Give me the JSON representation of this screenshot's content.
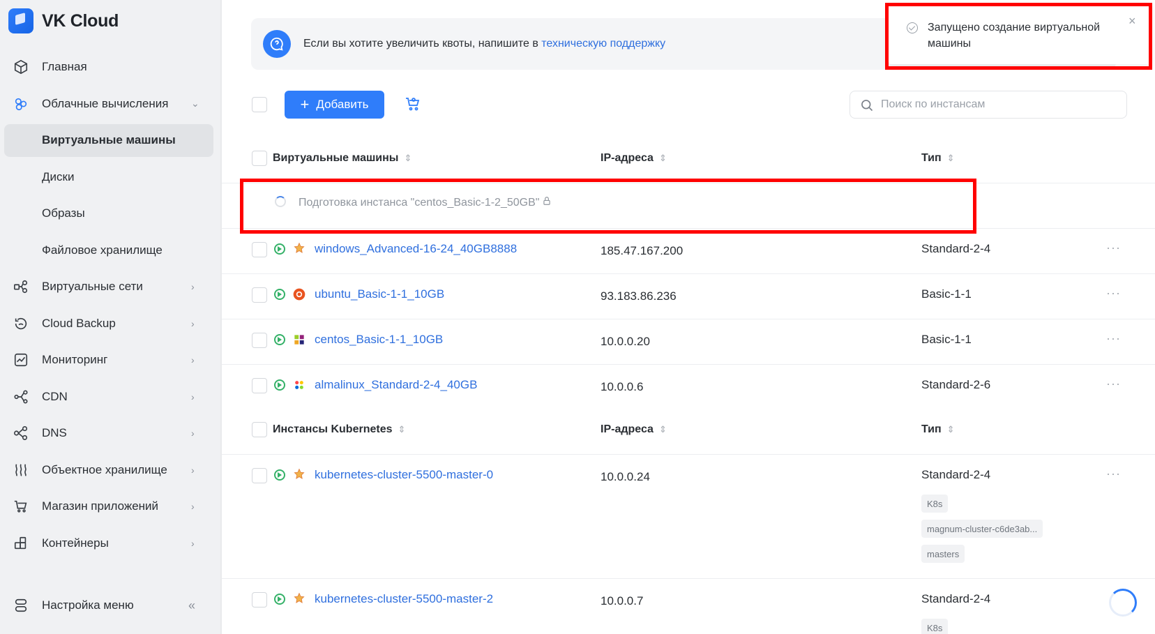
{
  "brand": {
    "name": "VK Cloud"
  },
  "sidebar": {
    "items": [
      {
        "label": "Главная",
        "icon": "cube-icon",
        "chevron": ""
      },
      {
        "label": "Облачные вычисления",
        "icon": "cloud-compute-icon",
        "chevron": "⌄"
      },
      {
        "label": "Виртуальные машины",
        "icon": "",
        "chevron": "",
        "active": true
      },
      {
        "label": "Диски",
        "icon": "",
        "chevron": ""
      },
      {
        "label": "Образы",
        "icon": "",
        "chevron": ""
      },
      {
        "label": "Файловое хранилище",
        "icon": "",
        "chevron": ""
      },
      {
        "label": "Виртуальные сети",
        "icon": "network-icon",
        "chevron": "›"
      },
      {
        "label": "Cloud Backup",
        "icon": "backup-icon",
        "chevron": "›"
      },
      {
        "label": "Мониторинг",
        "icon": "monitoring-icon",
        "chevron": "›"
      },
      {
        "label": "CDN",
        "icon": "cdn-icon",
        "chevron": "›"
      },
      {
        "label": "DNS",
        "icon": "dns-icon",
        "chevron": "›"
      },
      {
        "label": "Объектное хранилище",
        "icon": "object-storage-icon",
        "chevron": "›"
      },
      {
        "label": "Магазин приложений",
        "icon": "store-icon",
        "chevron": "›"
      },
      {
        "label": "Контейнеры",
        "icon": "containers-icon",
        "chevron": "›"
      }
    ],
    "menu_settings": "Настройка меню",
    "collapse_glyph": "«"
  },
  "banner": {
    "text": "Если вы хотите увеличить квоты, напишите в ",
    "link": "техническую поддержку"
  },
  "toolbar": {
    "add_label": "Добавить",
    "search_placeholder": "Поиск по инстансам"
  },
  "vm_table": {
    "headers": {
      "name": "Виртуальные машины",
      "ip": "IP-адреса",
      "type": "Тип"
    },
    "preparing": "Подготовка инстанса \"centos_Basic-1-2_50GB\"",
    "rows": [
      {
        "name": "windows_Advanced-16-24_40GB8888",
        "ip": "185.47.167.200",
        "type": "Standard-2-4",
        "os": "windows"
      },
      {
        "name": "ubuntu_Basic-1-1_10GB",
        "ip": "93.183.86.236",
        "type": "Basic-1-1",
        "os": "ubuntu"
      },
      {
        "name": "centos_Basic-1-1_10GB",
        "ip": "10.0.0.20",
        "type": "Basic-1-1",
        "os": "centos"
      },
      {
        "name": "almalinux_Standard-2-4_40GB",
        "ip": "10.0.0.6",
        "type": "Standard-2-6",
        "os": "almalinux"
      }
    ]
  },
  "k8s_table": {
    "headers": {
      "name": "Инстансы Kubernetes",
      "ip": "IP-адреса",
      "type": "Тип"
    },
    "rows": [
      {
        "name": "kubernetes-cluster-5500-master-0",
        "ip": "10.0.0.24",
        "type": "Standard-2-4",
        "tags": [
          "K8s",
          "magnum-cluster-c6de3ab...",
          "masters"
        ]
      },
      {
        "name": "kubernetes-cluster-5500-master-2",
        "ip": "10.0.0.7",
        "type": "Standard-2-4",
        "tags": [
          "K8s"
        ]
      }
    ]
  },
  "toast": {
    "text": "Запущено создание виртуальной машины",
    "close": "×"
  },
  "more_glyph": "···",
  "sort_glyph": "⇕",
  "colors": {
    "accent": "#2f7dfa",
    "link": "#2f6fde",
    "running": "#34b168",
    "annotation": "#ff0000"
  }
}
